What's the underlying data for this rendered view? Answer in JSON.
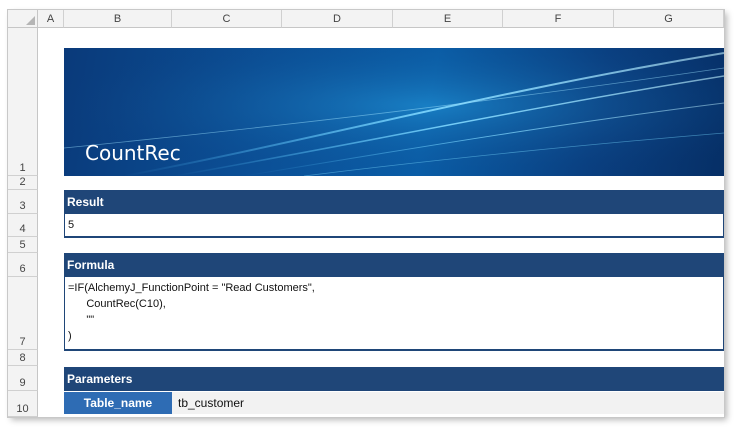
{
  "columns": [
    "A",
    "B",
    "C",
    "D",
    "E",
    "F",
    "G"
  ],
  "rows": [
    "1",
    "2",
    "3",
    "4",
    "5",
    "6",
    "7",
    "8",
    "9",
    "10"
  ],
  "banner": {
    "title": "CountRec"
  },
  "result": {
    "header": "Result",
    "value": "5"
  },
  "formula": {
    "header": "Formula",
    "lines": [
      "=IF(AlchemyJ_FunctionPoint = \"Read Customers\",",
      "      CountRec(C10),",
      "      \"\"",
      ")"
    ]
  },
  "parameters": {
    "header": "Parameters",
    "items": [
      {
        "label": "Table_name",
        "value": "tb_customer"
      }
    ]
  },
  "colors": {
    "header_bg": "#1f4678",
    "param_label_bg": "#2e6cb4",
    "banner_bg": "#0b4f96"
  }
}
